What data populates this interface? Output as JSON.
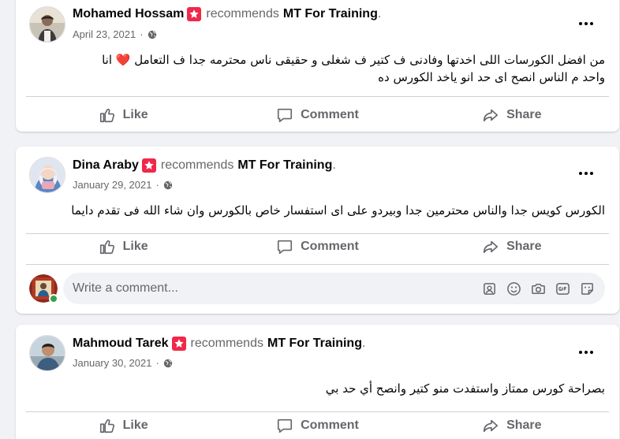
{
  "posts": [
    {
      "author": "Mohamed Hossam",
      "recommends": "recommends",
      "page": "MT For Training",
      "period": ".",
      "date": "April 23, 2021",
      "dot": "·",
      "text_line1": "من افضل الكورسات اللى اخدتها وفادنى ف كتير ف شغلى و حقيقى ناس محترمه جدا ف التعامل ❤️ انا",
      "text_line2": "واحد م الناس انصح اى حد انو ياخد الكورس ده"
    },
    {
      "author": "Dina Araby",
      "recommends": "recommends",
      "page": "MT For Training",
      "period": ".",
      "date": "January 29, 2021",
      "dot": "·",
      "text_line1": "الكورس كويس جدا والناس محترمين جدا وبيردو على اى استفسار خاص بالكورس وان شاء الله فى تقدم دايما"
    },
    {
      "author": "Mahmoud Tarek",
      "recommends": "recommends",
      "page": "MT For Training",
      "period": ".",
      "date": "January 30, 2021",
      "dot": "·",
      "text_line1": "بصراحة كورس ممتاز واستفدت منو كتير وانصح أي حد بي"
    }
  ],
  "actions": {
    "like": "Like",
    "comment": "Comment",
    "share": "Share"
  },
  "comment_box": {
    "placeholder": "Write a comment..."
  },
  "icons": [
    "recommend-star-icon",
    "globe-icon",
    "more-options-icon",
    "like-thumb-icon",
    "comment-bubble-icon",
    "share-arrow-icon",
    "avatar-frame-icon",
    "emoji-icon",
    "camera-icon",
    "gif-icon",
    "sticker-icon"
  ],
  "colors": {
    "background": "#f0f2f5",
    "recommend_badge": "#f02849",
    "secondary_text": "#65676b",
    "online_dot": "#31a24c"
  }
}
